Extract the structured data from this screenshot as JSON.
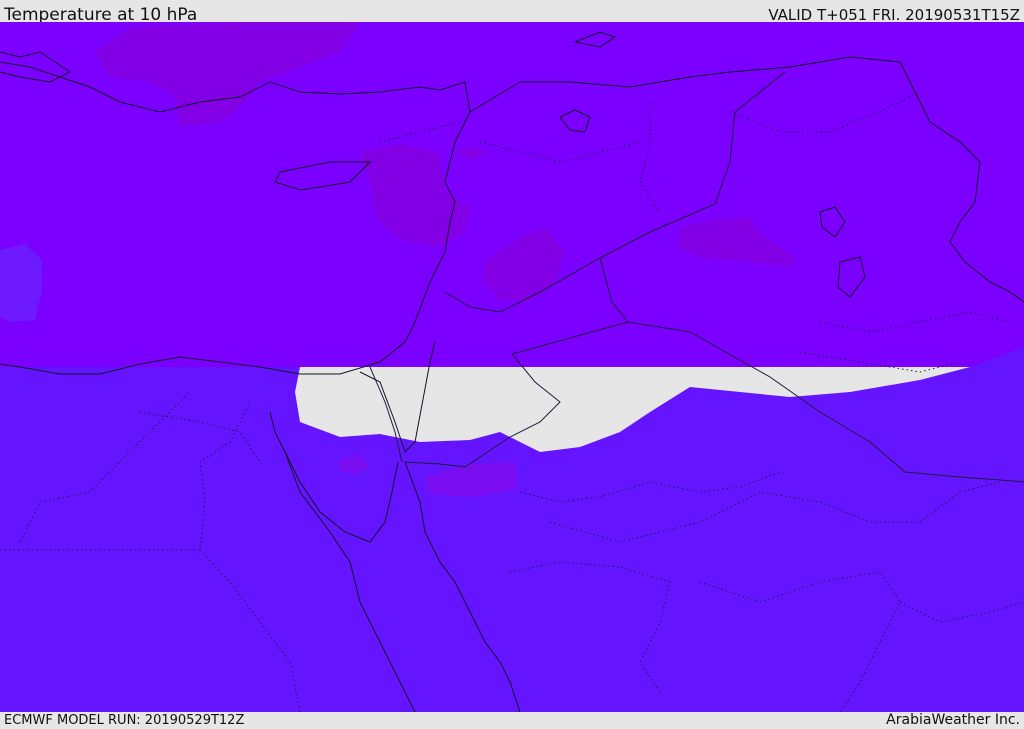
{
  "header": {
    "title": "Temperature at 10 hPa",
    "valid": "VALID T+051 FRI. 20190531T15Z"
  },
  "footer": {
    "model_run": "ECMWF MODEL RUN: 20190529T12Z",
    "credit": "ArabiaWeather Inc."
  },
  "colors": {
    "warm_band": "#7c00ff",
    "cool_band": "#6414ff",
    "warm_pocket": "#8300e6",
    "cool_pocket": "#6e1aff",
    "mid_pocket": "#7a0cf0",
    "coastline": "#141428",
    "border": "#1e1e3c"
  }
}
